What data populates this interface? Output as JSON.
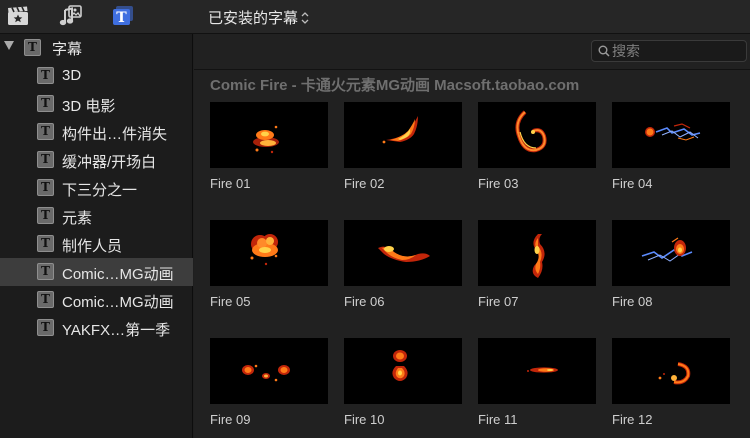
{
  "toolbar": {
    "icons": [
      "clapper-star-icon",
      "music-photo-icon",
      "titles-icon"
    ],
    "library_title": "已安装的字幕"
  },
  "sidebar": {
    "root": {
      "label": "字幕",
      "expanded": true
    },
    "items": [
      {
        "label": "3D",
        "selected": false
      },
      {
        "label": "3D 电影",
        "selected": false
      },
      {
        "label": "构件出…件消失",
        "selected": false
      },
      {
        "label": "缓冲器/开场白",
        "selected": false
      },
      {
        "label": "下三分之一",
        "selected": false
      },
      {
        "label": "元素",
        "selected": false
      },
      {
        "label": "制作人员",
        "selected": false
      },
      {
        "label": "Comic…MG动画",
        "selected": true
      },
      {
        "label": "Comic…MG动画",
        "selected": false
      },
      {
        "label": "YAKFX…第一季",
        "selected": false
      }
    ]
  },
  "browser": {
    "search_placeholder": "搜索",
    "group_title": "Comic Fire - 卡通火元素MG动画 Macsoft.taobao.com",
    "clips": [
      {
        "name": "Fire 01"
      },
      {
        "name": "Fire 02"
      },
      {
        "name": "Fire 03"
      },
      {
        "name": "Fire 04"
      },
      {
        "name": "Fire 05"
      },
      {
        "name": "Fire 06"
      },
      {
        "name": "Fire 07"
      },
      {
        "name": "Fire 08"
      },
      {
        "name": "Fire 09"
      },
      {
        "name": "Fire 10"
      },
      {
        "name": "Fire 11"
      },
      {
        "name": "Fire 12"
      }
    ]
  },
  "colors": {
    "accent": "#3f6fe0",
    "fire_core": "#ffd24a",
    "fire_mid": "#ff7a18",
    "fire_edge": "#c2260a",
    "electric": "#5c8cff"
  }
}
